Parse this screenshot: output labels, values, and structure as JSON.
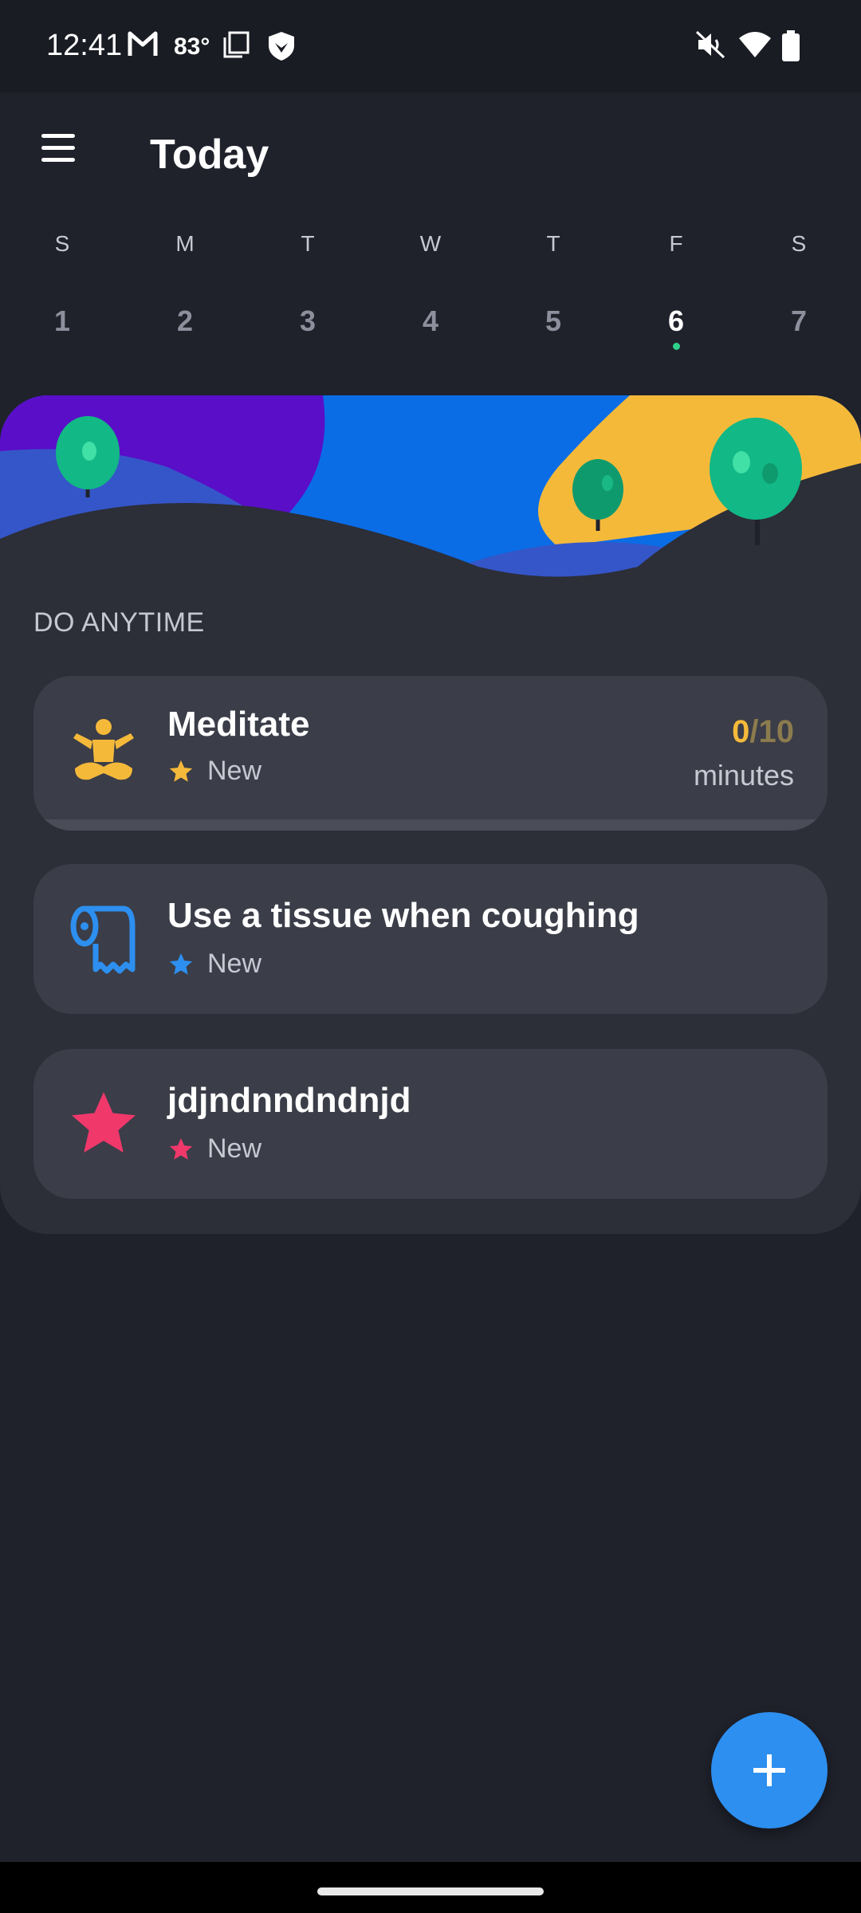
{
  "status_bar": {
    "time": "12:41",
    "temperature": "83°",
    "icons": [
      "gmail-icon",
      "screenshot-icon",
      "shield-icon",
      "mute-icon",
      "wifi-icon",
      "battery-icon"
    ]
  },
  "app_bar": {
    "title": "Today",
    "menu_icon": "hamburger-menu-icon"
  },
  "week": {
    "days": [
      {
        "dow": "S",
        "dom": "1",
        "active": false
      },
      {
        "dow": "M",
        "dom": "2",
        "active": false
      },
      {
        "dow": "T",
        "dom": "3",
        "active": false
      },
      {
        "dow": "W",
        "dom": "4",
        "active": false
      },
      {
        "dow": "T",
        "dom": "5",
        "active": false
      },
      {
        "dow": "F",
        "dom": "6",
        "active": true
      },
      {
        "dow": "S",
        "dom": "7",
        "active": false
      }
    ]
  },
  "section": {
    "label": "DO ANYTIME"
  },
  "habits": [
    {
      "title": "Meditate",
      "status": "New",
      "icon": "meditate-icon",
      "accent": "#f5b93a",
      "progress_current": "0",
      "progress_total": "/10",
      "unit": "minutes",
      "progress_fraction": 0
    },
    {
      "title": "Use a tissue when coughing",
      "status": "New",
      "icon": "tissue-roll-icon",
      "accent": "#2d8fef"
    },
    {
      "title": "jdjndnndndnjd",
      "status": "New",
      "icon": "star-icon",
      "accent": "#f0386b"
    }
  ],
  "fab": {
    "icon": "plus-icon"
  },
  "colors": {
    "background": "#1f212b",
    "panel": "#2c2e38",
    "card": "#3b3d48",
    "active_dot": "#2fd18a",
    "fab": "#2d8fef"
  }
}
